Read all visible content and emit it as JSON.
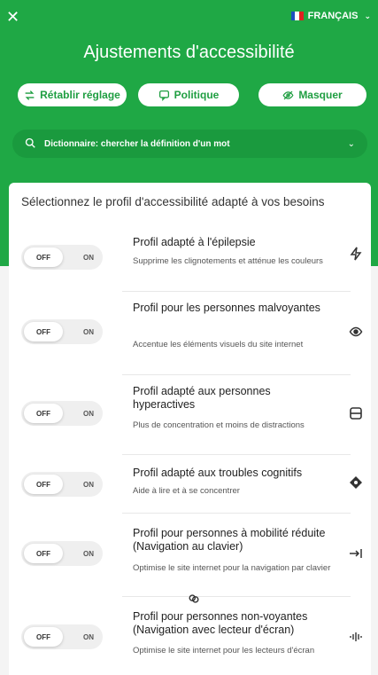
{
  "header": {
    "close_glyph": "✕",
    "language": "FRANÇAIS",
    "title": "Ajustements d'accessibilité",
    "flag_colors": [
      "#1f4fbf",
      "#ffffff",
      "#e02020"
    ]
  },
  "actions": {
    "reset_label": "Rétablir réglage",
    "policy_label": "Politique",
    "hide_label": "Masquer"
  },
  "search": {
    "text": "Dictionnaire: chercher la définition d'un mot"
  },
  "card": {
    "heading": "Sélectionnez le profil d'accessibilité adapté à vos besoins"
  },
  "toggle": {
    "off": "OFF",
    "on": "ON"
  },
  "profiles": [
    {
      "title": "Profil adapté à l'épilepsie",
      "desc": "Supprime les clignotements et atténue les couleurs",
      "icon": "bolt-icon"
    },
    {
      "title": "Profil pour les personnes malvoyantes",
      "desc": "Accentue les éléments visuels du site internet",
      "icon": "eye-icon"
    },
    {
      "title": "Profil adapté aux personnes hyperactives",
      "desc": "Plus de concentration et moins de distractions",
      "icon": "focus-box-icon"
    },
    {
      "title": "Profil adapté aux troubles cognitifs",
      "desc": "Aide à lire et à se concentrer",
      "icon": "compass-icon"
    },
    {
      "title": "Profil pour personnes à mobilité réduite (Navigation au clavier)",
      "desc": "Optimise le site internet pour la navigation par clavier",
      "icon": "arrow-to-bar-icon"
    },
    {
      "title": "Profil pour personnes non-voyantes (Navigation avec lecteur d'écran)",
      "desc": "Optimise le site internet pour les lecteurs d'écran",
      "icon": "audio-wave-icon"
    }
  ],
  "colors": {
    "brand_green": "#1fa845",
    "search_green": "#1a9a3e"
  }
}
